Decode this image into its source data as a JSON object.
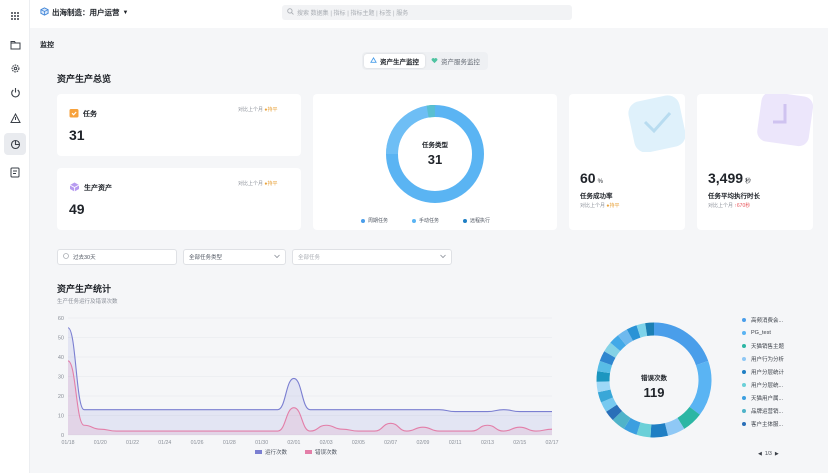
{
  "header": {
    "workspace": "出海制造：用户运营",
    "search_placeholder": "搜索 数据集 | 指标 | 指标主题 | 标签 | 服务"
  },
  "sidebar": {
    "icons": [
      "grid-icon",
      "folder-icon",
      "gear-icon",
      "power-icon",
      "warning-icon",
      "pie-icon",
      "report-icon"
    ]
  },
  "page": {
    "section_label": "监控",
    "tabs": [
      {
        "label": "资产生产监控",
        "active": true
      },
      {
        "label": "资产服务监控",
        "active": false
      }
    ]
  },
  "overview": {
    "title": "资产生产总览",
    "tasks": {
      "label": "任务",
      "value": "31",
      "compare_label": "对比上个月",
      "compare_value": "持平"
    },
    "assets": {
      "label": "生产资产",
      "value": "49",
      "compare_label": "对比上个月",
      "compare_value": "持平"
    },
    "task_type_donut": {
      "center_label": "任务类型",
      "center_value": "31",
      "legend": [
        "周期任务",
        "手动任务",
        "远程执行"
      ]
    },
    "success_rate": {
      "value": "60",
      "unit": "%",
      "label": "任务成功率",
      "compare_label": "对比上个月",
      "compare_value": "持平"
    },
    "avg_duration": {
      "value": "3,499",
      "unit": "秒",
      "label": "任务平均执行时长",
      "compare_label": "对比上个月",
      "compare_value": "↑670秒"
    }
  },
  "filters": {
    "date_range": "过去30天",
    "task_type": "全部任务类型",
    "task": "全部任务"
  },
  "stats": {
    "title": "资产生产统计",
    "subtitle": "生产任务运行及错误次数",
    "legend_run": "运行次数",
    "legend_error": "错误次数",
    "error_donut": {
      "center_label": "错误次数",
      "center_value": "119"
    },
    "right_legend": [
      "高频消费会...",
      "PG_test",
      "天猫销售主题",
      "用户行为分析",
      "用户分层统计",
      "用户分层统...",
      "天猫用户属...",
      "品牌运营销...",
      "客户主体服..."
    ],
    "pager": "1/3"
  },
  "colors": {
    "accent": "#4a9eea",
    "run_line": "#7b7fd1",
    "error_line": "#e37ea8",
    "flat": "#e8a23a",
    "up": "#e8545a"
  },
  "chart_data": {
    "type": "line",
    "title": "",
    "xlabel": "",
    "ylabel": "",
    "ylim": [
      0,
      60
    ],
    "yticks": [
      0,
      10,
      20,
      30,
      40,
      50,
      60
    ],
    "x": [
      "01/18",
      "01/19",
      "01/20",
      "01/21",
      "01/22",
      "01/23",
      "01/24",
      "01/25",
      "01/26",
      "01/27",
      "01/28",
      "01/29",
      "01/30",
      "01/31",
      "02/01",
      "02/02",
      "02/03",
      "02/04",
      "02/05",
      "02/06",
      "02/07",
      "02/08",
      "02/09",
      "02/10",
      "02/11",
      "02/12",
      "02/13",
      "02/14",
      "02/15",
      "02/16",
      "02/17"
    ],
    "xticks": [
      "01/18",
      "01/20",
      "01/22",
      "01/24",
      "01/26",
      "01/28",
      "01/30",
      "02/01",
      "02/03",
      "02/05",
      "02/07",
      "02/09",
      "02/11",
      "02/13",
      "02/15",
      "02/17"
    ],
    "series": [
      {
        "name": "运行次数",
        "values": [
          55,
          13,
          13,
          13,
          13,
          13,
          13,
          13,
          13,
          13,
          13,
          13,
          13,
          13,
          29,
          13,
          13,
          13,
          13,
          13,
          13,
          13,
          13,
          13,
          12,
          12,
          12,
          13,
          12,
          12,
          12
        ]
      },
      {
        "name": "错误次数",
        "values": [
          38,
          5,
          3,
          2,
          2,
          2,
          2,
          2,
          2,
          2,
          2,
          2,
          2,
          2,
          14,
          2,
          5,
          3,
          2,
          2,
          6,
          2,
          4,
          2,
          2,
          2,
          5,
          2,
          4,
          2,
          3
        ]
      }
    ]
  }
}
